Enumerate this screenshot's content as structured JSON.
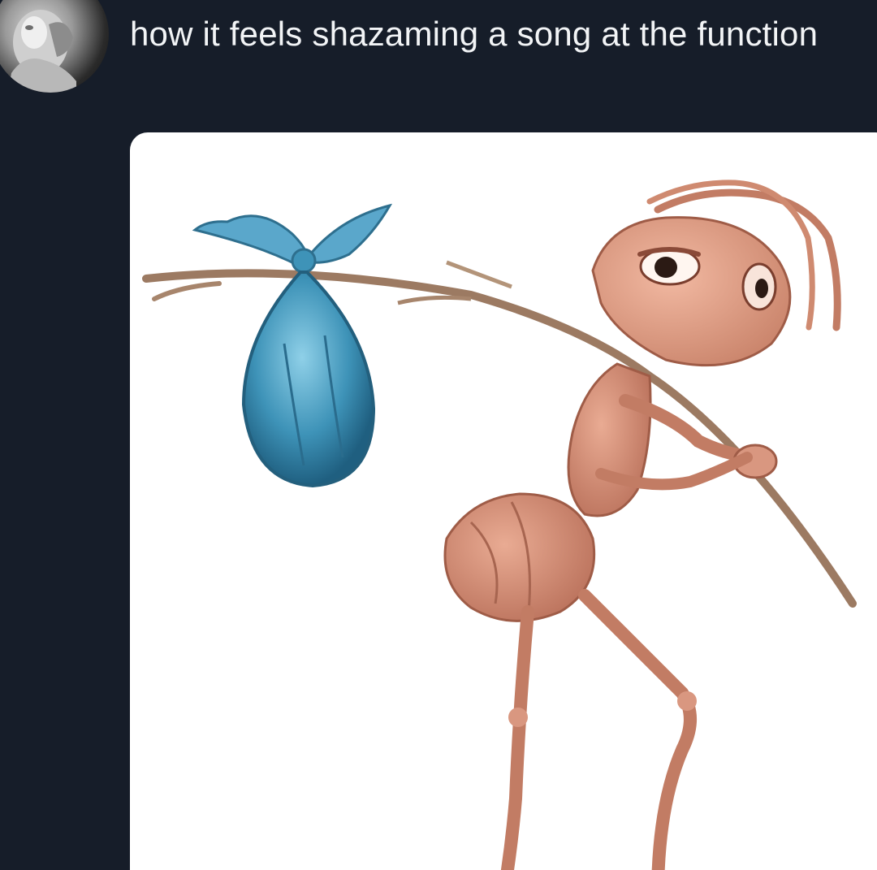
{
  "tweet": {
    "text": "how it feels shazaming a song at the function",
    "avatar_icon": "profile-avatar-statue-icon"
  },
  "media": {
    "image_icon": "ant-with-bindle-illustration",
    "background": "#ffffff"
  },
  "theme": {
    "background": "#161d29",
    "text_color": "#f2f4f6"
  }
}
